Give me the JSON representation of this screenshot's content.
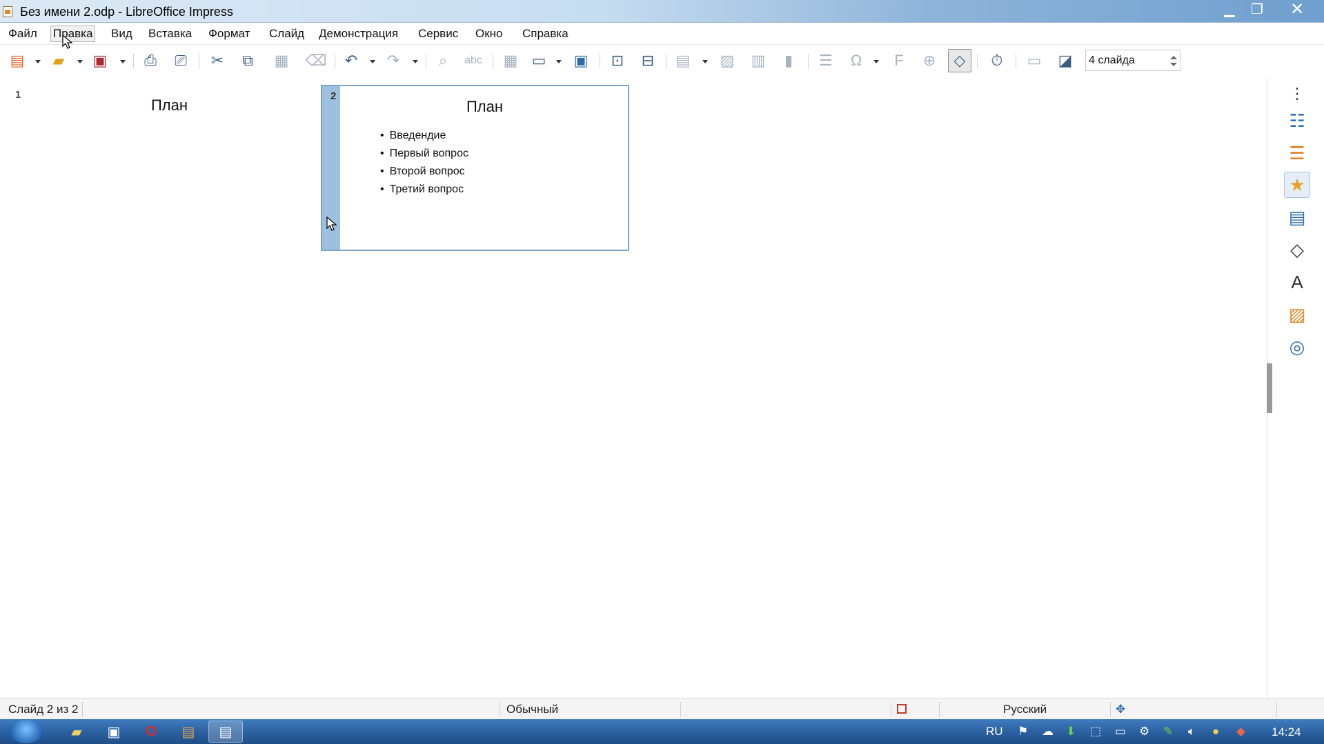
{
  "window": {
    "title": "Без имени 2.odp - LibreOffice Impress",
    "minimize": "▁",
    "restore": "❐",
    "close": "✕"
  },
  "menu": [
    "Файл",
    "Правка",
    "Вид",
    "Вставка",
    "Формат",
    "Слайд",
    "Демонстрация",
    "Сервис",
    "Окно",
    "Справка"
  ],
  "toolbar": {
    "slides_per_row": "4 слайда",
    "icons": [
      "new-icon",
      "open-icon",
      "save-icon",
      "export-pdf-icon",
      "print-icon",
      "cut-icon",
      "copy-icon",
      "paste-icon",
      "clone-formatting-icon",
      "undo-icon",
      "redo-icon",
      "find-replace-icon",
      "spelling-icon",
      "grid-icon",
      "display-views-icon",
      "master-slide-icon",
      "start-first-slide-icon",
      "start-current-slide-icon",
      "table-icon",
      "image-icon",
      "media-icon",
      "chart-icon",
      "textbox-icon",
      "special-character-icon",
      "fontwork-icon",
      "hyperlink-icon",
      "show-draw-functions-icon",
      "rehearse-timings-icon",
      "header-footer-icon",
      "slide-transition-icon"
    ]
  },
  "slides": [
    {
      "number": "1",
      "title": "План",
      "bullets": []
    },
    {
      "number": "2",
      "title": "План",
      "bullets": [
        "Введендие",
        "Первый вопрос",
        "Второй вопрос",
        "Третий вопрос"
      ]
    }
  ],
  "sidebar": {
    "menu_glyph": "⋮",
    "icons": [
      "properties-icon",
      "slide-transition-icon",
      "animation-icon",
      "master-slides-icon",
      "shapes-icon",
      "styles-icon",
      "gallery-icon",
      "navigator-icon"
    ]
  },
  "status": {
    "slide_info": "Слайд 2 из 2",
    "layout": "Обычный",
    "language": "Русский"
  },
  "taskbar": {
    "language": "RU",
    "time": "14:24"
  },
  "colors": {
    "selection_strip": "#9ec0e0",
    "selection_border": "#7ea3c9",
    "taskbar": "#2a5f9e"
  }
}
